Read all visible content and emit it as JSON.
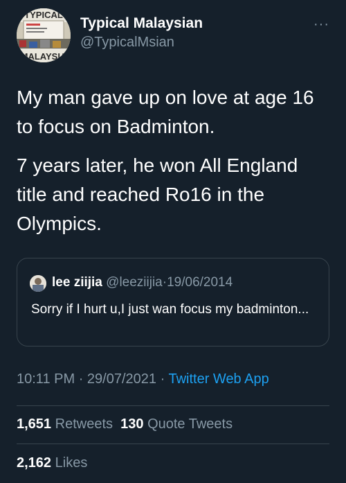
{
  "author": {
    "name": "Typical Malaysian",
    "handle": "@TypicalMsian",
    "avatar_text_top": "TYPICAL",
    "avatar_text_bottom": "MALAYSIA"
  },
  "more_icon": "more-horizontal-icon",
  "more_glyph": "···",
  "body": {
    "paragraph1": "My man gave up on love at age 16 to focus on Badminton.",
    "paragraph2": "7 years later, he won All England title and reached Ro16 in the Olympics."
  },
  "quoted": {
    "name": "lee ziijia",
    "handle": "@leeziijia",
    "separator": "·",
    "date": "19/06/2014",
    "text": "Sorry if I hurt u,I just wan focus my badminton..."
  },
  "meta": {
    "time": "10:11 PM",
    "separator": "·",
    "date": "29/07/2021",
    "app": "Twitter Web App"
  },
  "stats": {
    "retweets_count": "1,651",
    "retweets_label": "Retweets",
    "quotes_count": "130",
    "quotes_label": "Quote Tweets",
    "likes_count": "2,162",
    "likes_label": "Likes"
  },
  "colors": {
    "background": "#15202b",
    "secondary_text": "#8899a6",
    "link": "#1da1f2",
    "border": "#38444d"
  }
}
